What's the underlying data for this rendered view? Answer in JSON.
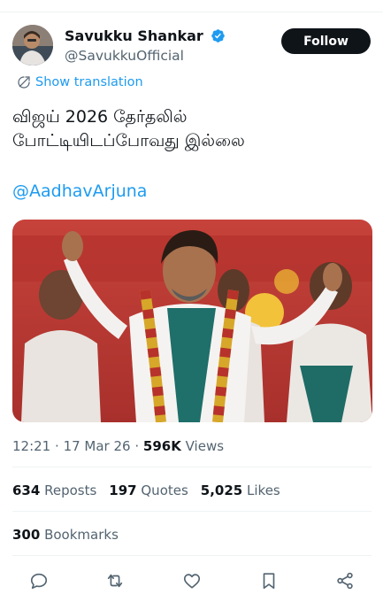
{
  "author": {
    "display_name": "Savukku Shankar",
    "handle": "@SavukkuOfficial",
    "verified": true
  },
  "follow_label": "Follow",
  "translation_label": "Show translation",
  "tweet": {
    "line1": "விஜய் 2026 தேர்தலில்",
    "line2": "போட்டியிடப்போவது இல்லை",
    "mention": "@AadhavArjuna"
  },
  "meta": {
    "time": "12:21",
    "date": "17 Mar 26",
    "views_count": "596K",
    "views_label": "Views"
  },
  "stats": {
    "reposts_count": "634",
    "reposts_label": "Reposts",
    "quotes_count": "197",
    "quotes_label": "Quotes",
    "likes_count": "5,025",
    "likes_label": "Likes",
    "bookmarks_count": "300",
    "bookmarks_label": "Bookmarks"
  },
  "colors": {
    "accent": "#1d9bf0",
    "text": "#0f1419",
    "muted": "#536471",
    "divider": "#eff3f4"
  },
  "icons": [
    "verified-badge-icon",
    "translate-icon",
    "reply-icon",
    "repost-icon",
    "like-icon",
    "bookmark-icon",
    "share-icon"
  ]
}
